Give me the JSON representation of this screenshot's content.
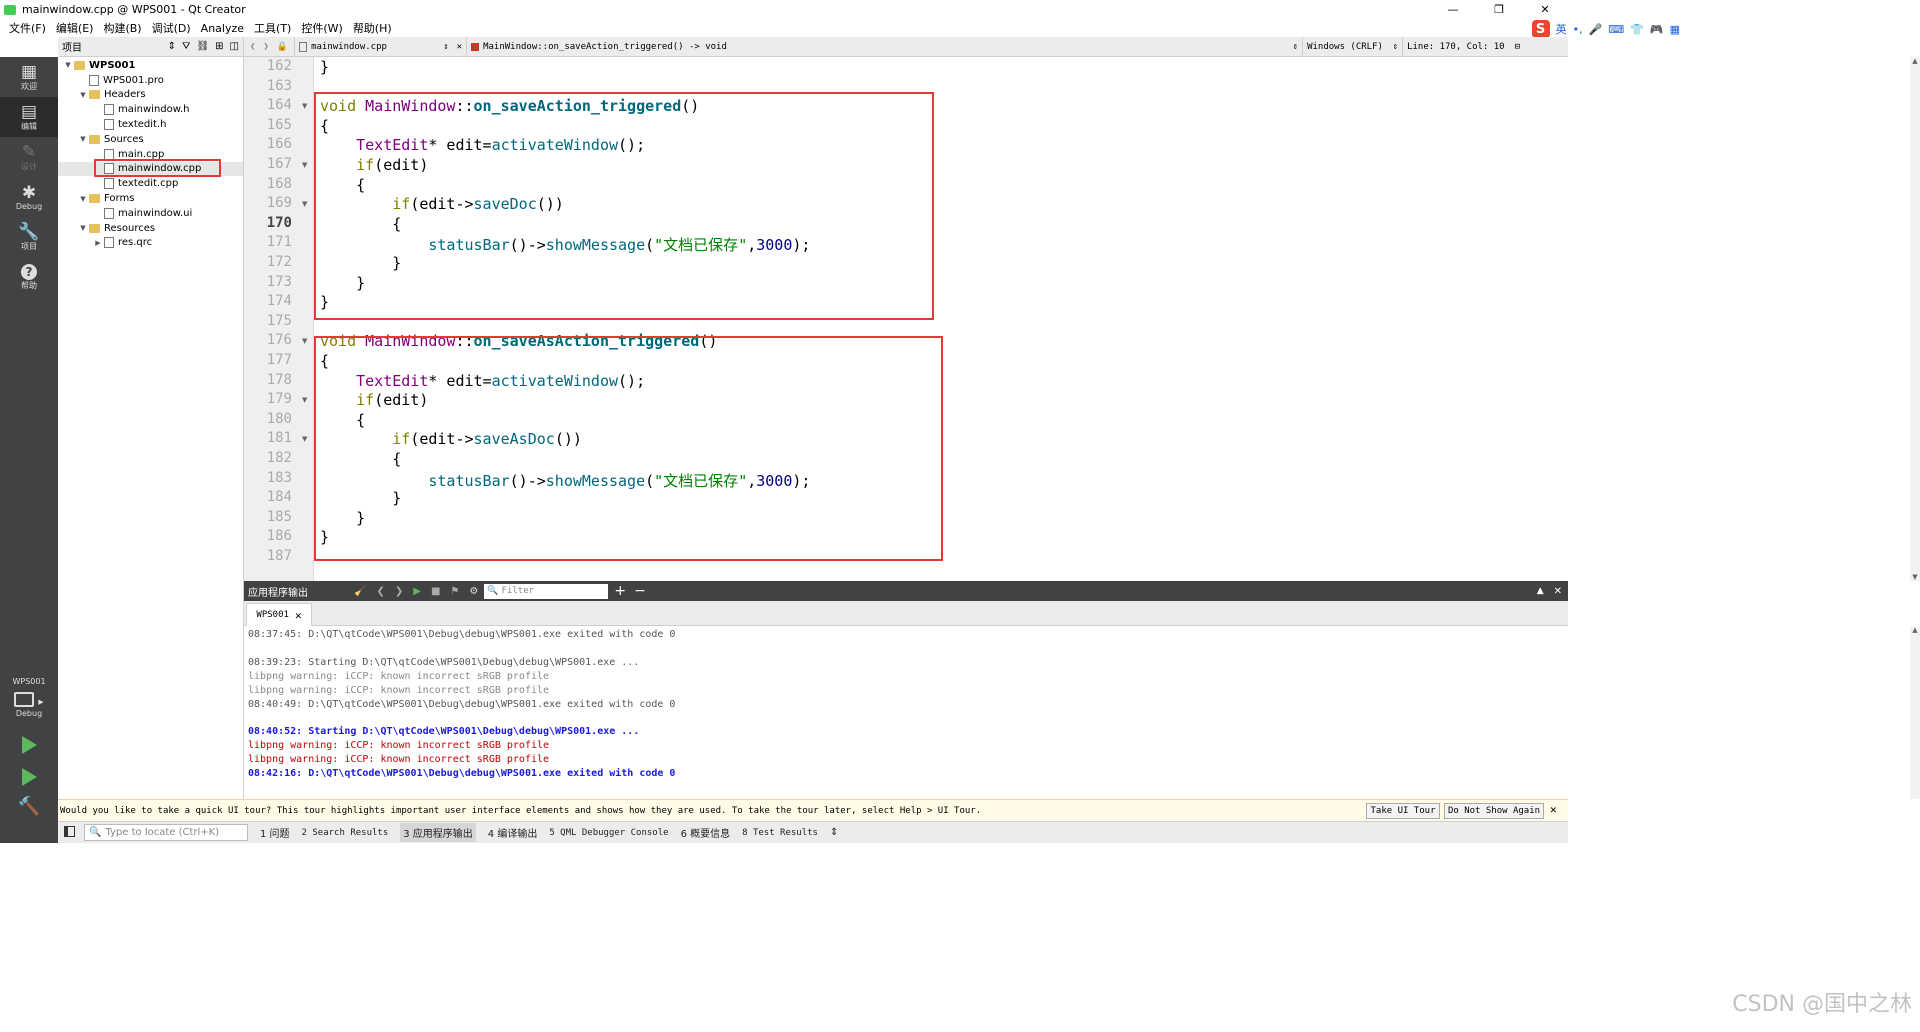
{
  "window": {
    "title": "mainwindow.cpp @ WPS001 - Qt Creator",
    "minimize": "—",
    "restore": "❐",
    "close": "✕"
  },
  "menu": [
    "文件(F)",
    "编辑(E)",
    "构建(B)",
    "调试(D)",
    "Analyze",
    "工具(T)",
    "控件(W)",
    "帮助(H)"
  ],
  "ime": {
    "logo": "S",
    "lang": "英"
  },
  "modes": [
    {
      "label": "欢迎",
      "icon": "▦"
    },
    {
      "label": "编辑",
      "icon": "▤"
    },
    {
      "label": "设计",
      "icon": "✎"
    },
    {
      "label": "Debug",
      "icon": "✱"
    },
    {
      "label": "项目",
      "icon": "🔧"
    },
    {
      "label": "帮助",
      "icon": "?"
    }
  ],
  "kit": {
    "project": "WPS001",
    "config": "Debug"
  },
  "project_panel": {
    "title": "项目",
    "tree": [
      {
        "label": "WPS001",
        "level": 0,
        "kind": "project",
        "arrow": "▼",
        "bold": true
      },
      {
        "label": "WPS001.pro",
        "level": 1,
        "kind": "file",
        "arrow": ""
      },
      {
        "label": "Headers",
        "level": 1,
        "kind": "folder",
        "arrow": "▼"
      },
      {
        "label": "mainwindow.h",
        "level": 2,
        "kind": "file",
        "arrow": ""
      },
      {
        "label": "textedit.h",
        "level": 2,
        "kind": "file",
        "arrow": ""
      },
      {
        "label": "Sources",
        "level": 1,
        "kind": "folder",
        "arrow": "▼"
      },
      {
        "label": "main.cpp",
        "level": 2,
        "kind": "file",
        "arrow": ""
      },
      {
        "label": "mainwindow.cpp",
        "level": 2,
        "kind": "file",
        "arrow": "",
        "selected": true
      },
      {
        "label": "textedit.cpp",
        "level": 2,
        "kind": "file",
        "arrow": ""
      },
      {
        "label": "Forms",
        "level": 1,
        "kind": "folder",
        "arrow": "▼"
      },
      {
        "label": "mainwindow.ui",
        "level": 2,
        "kind": "file",
        "arrow": ""
      },
      {
        "label": "Resources",
        "level": 1,
        "kind": "folder",
        "arrow": "▼"
      },
      {
        "label": "res.qrc",
        "level": 2,
        "kind": "file",
        "arrow": "▶"
      }
    ]
  },
  "editor_toolbar": {
    "file": "mainwindow.cpp",
    "symbol": "MainWindow::on_saveAction_triggered() -> void",
    "line_ending": "Windows (CRLF)",
    "position": "Line: 170, Col: 10"
  },
  "editor": {
    "current_line": 170,
    "lines": [
      {
        "n": 162,
        "fold": false,
        "code": [
          {
            "t": "}",
            "c": ""
          }
        ]
      },
      {
        "n": 163,
        "fold": false,
        "code": []
      },
      {
        "n": 164,
        "fold": true,
        "code": [
          {
            "t": "void ",
            "c": "kw"
          },
          {
            "t": "MainWindow",
            "c": "ty"
          },
          {
            "t": "::",
            "c": ""
          },
          {
            "t": "on_saveAction_triggered",
            "c": "fnb"
          },
          {
            "t": "()",
            "c": ""
          }
        ]
      },
      {
        "n": 165,
        "fold": false,
        "code": [
          {
            "t": "{",
            "c": ""
          }
        ]
      },
      {
        "n": 166,
        "fold": false,
        "code": [
          {
            "t": "    ",
            "c": ""
          },
          {
            "t": "TextEdit",
            "c": "ty"
          },
          {
            "t": "* edit=",
            "c": ""
          },
          {
            "t": "activateWindow",
            "c": "fn"
          },
          {
            "t": "();",
            "c": ""
          }
        ]
      },
      {
        "n": 167,
        "fold": true,
        "code": [
          {
            "t": "    ",
            "c": ""
          },
          {
            "t": "if",
            "c": "kw"
          },
          {
            "t": "(edit)",
            "c": ""
          }
        ]
      },
      {
        "n": 168,
        "fold": false,
        "code": [
          {
            "t": "    {",
            "c": ""
          }
        ]
      },
      {
        "n": 169,
        "fold": true,
        "code": [
          {
            "t": "        ",
            "c": ""
          },
          {
            "t": "if",
            "c": "kw"
          },
          {
            "t": "(edit->",
            "c": ""
          },
          {
            "t": "saveDoc",
            "c": "fn"
          },
          {
            "t": "())",
            "c": ""
          }
        ]
      },
      {
        "n": 170,
        "fold": false,
        "code": [
          {
            "t": "        {",
            "c": ""
          }
        ]
      },
      {
        "n": 171,
        "fold": false,
        "code": [
          {
            "t": "            ",
            "c": ""
          },
          {
            "t": "statusBar",
            "c": "fn"
          },
          {
            "t": "()->",
            "c": ""
          },
          {
            "t": "showMessage",
            "c": "fn"
          },
          {
            "t": "(",
            "c": ""
          },
          {
            "t": "\"文档已保存\"",
            "c": "str"
          },
          {
            "t": ",",
            "c": ""
          },
          {
            "t": "3000",
            "c": "num"
          },
          {
            "t": ");",
            "c": ""
          }
        ]
      },
      {
        "n": 172,
        "fold": false,
        "code": [
          {
            "t": "        }",
            "c": ""
          }
        ]
      },
      {
        "n": 173,
        "fold": false,
        "code": [
          {
            "t": "    }",
            "c": ""
          }
        ]
      },
      {
        "n": 174,
        "fold": false,
        "code": [
          {
            "t": "}",
            "c": ""
          }
        ]
      },
      {
        "n": 175,
        "fold": false,
        "code": []
      },
      {
        "n": 176,
        "fold": true,
        "code": [
          {
            "t": "void ",
            "c": "kw"
          },
          {
            "t": "MainWindow",
            "c": "ty"
          },
          {
            "t": "::",
            "c": ""
          },
          {
            "t": "on_saveAsAction_triggered",
            "c": "fnb"
          },
          {
            "t": "()",
            "c": ""
          }
        ]
      },
      {
        "n": 177,
        "fold": false,
        "code": [
          {
            "t": "{",
            "c": ""
          }
        ]
      },
      {
        "n": 178,
        "fold": false,
        "code": [
          {
            "t": "    ",
            "c": ""
          },
          {
            "t": "TextEdit",
            "c": "ty"
          },
          {
            "t": "* edit=",
            "c": ""
          },
          {
            "t": "activateWindow",
            "c": "fn"
          },
          {
            "t": "();",
            "c": ""
          }
        ]
      },
      {
        "n": 179,
        "fold": true,
        "code": [
          {
            "t": "    ",
            "c": ""
          },
          {
            "t": "if",
            "c": "kw"
          },
          {
            "t": "(edit)",
            "c": ""
          }
        ]
      },
      {
        "n": 180,
        "fold": false,
        "code": [
          {
            "t": "    {",
            "c": ""
          }
        ]
      },
      {
        "n": 181,
        "fold": true,
        "code": [
          {
            "t": "        ",
            "c": ""
          },
          {
            "t": "if",
            "c": "kw"
          },
          {
            "t": "(edit->",
            "c": ""
          },
          {
            "t": "saveAsDoc",
            "c": "fn"
          },
          {
            "t": "())",
            "c": ""
          }
        ]
      },
      {
        "n": 182,
        "fold": false,
        "code": [
          {
            "t": "        {",
            "c": ""
          }
        ]
      },
      {
        "n": 183,
        "fold": false,
        "code": [
          {
            "t": "            ",
            "c": ""
          },
          {
            "t": "statusBar",
            "c": "fn"
          },
          {
            "t": "()->",
            "c": ""
          },
          {
            "t": "showMessage",
            "c": "fn"
          },
          {
            "t": "(",
            "c": ""
          },
          {
            "t": "\"文档已保存\"",
            "c": "str"
          },
          {
            "t": ",",
            "c": ""
          },
          {
            "t": "3000",
            "c": "num"
          },
          {
            "t": ");",
            "c": ""
          }
        ]
      },
      {
        "n": 184,
        "fold": false,
        "code": [
          {
            "t": "        }",
            "c": ""
          }
        ]
      },
      {
        "n": 185,
        "fold": false,
        "code": [
          {
            "t": "    }",
            "c": ""
          }
        ]
      },
      {
        "n": 186,
        "fold": false,
        "code": [
          {
            "t": "}",
            "c": ""
          }
        ]
      },
      {
        "n": 187,
        "fold": false,
        "code": []
      }
    ]
  },
  "output_pane": {
    "title": "应用程序输出",
    "filter_placeholder": "Filter",
    "tab": "WPS001",
    "lines": [
      {
        "text": "08:37:45: D:\\QT\\qtCode\\WPS001\\Debug\\debug\\WPS001.exe exited with code 0",
        "style": "normal"
      },
      {
        "text": "",
        "style": "normal"
      },
      {
        "text": "08:39:23: Starting D:\\QT\\qtCode\\WPS001\\Debug\\debug\\WPS001.exe ...",
        "style": "normal"
      },
      {
        "text": "libpng warning: iCCP: known incorrect sRGB profile",
        "style": "gray"
      },
      {
        "text": "libpng warning: iCCP: known incorrect sRGB profile",
        "style": "gray"
      },
      {
        "text": "08:40:49: D:\\QT\\qtCode\\WPS001\\Debug\\debug\\WPS001.exe exited with code 0",
        "style": "normal"
      },
      {
        "text": "",
        "style": "normal"
      },
      {
        "text": "08:40:52: Starting D:\\QT\\qtCode\\WPS001\\Debug\\debug\\WPS001.exe ...",
        "style": "blue"
      },
      {
        "text": "libpng warning: iCCP: known incorrect sRGB profile",
        "style": "red"
      },
      {
        "text": "libpng warning: iCCP: known incorrect sRGB profile",
        "style": "red"
      },
      {
        "text": "08:42:16: D:\\QT\\qtCode\\WPS001\\Debug\\debug\\WPS001.exe exited with code 0",
        "style": "blue"
      }
    ]
  },
  "tour": {
    "message": "Would you like to take a quick UI tour? This tour highlights important user interface elements and shows how they are used. To take the tour later, select Help > UI Tour.",
    "take_label": "Take UI Tour",
    "dismiss_label": "Do Not Show Again"
  },
  "statusbar": {
    "locator_placeholder": "Type to locate (Ctrl+K)",
    "panes": [
      "1 问题",
      "2 Search Results",
      "3 应用程序输出",
      "4 编译输出",
      "5 QML Debugger Console",
      "6 概要信息",
      "8 Test Results"
    ]
  },
  "watermark": "CSDN @国中之林",
  "colors": {
    "highlight_box": "#e53935",
    "sidebar": "#404244",
    "keyword": "#808000",
    "type": "#800080",
    "function": "#00677c",
    "string": "#008000",
    "number": "#000080"
  }
}
